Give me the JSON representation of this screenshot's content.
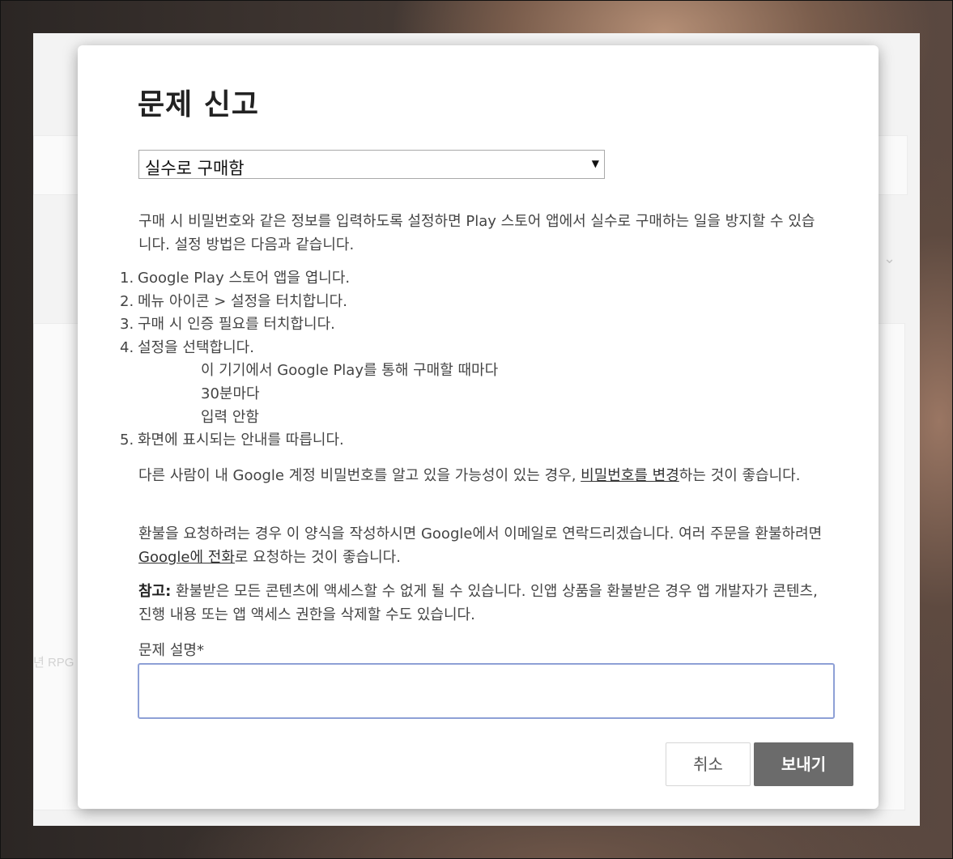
{
  "background": {
    "page_fragment_text": "년 RPG",
    "chevron_glyph": "⌄"
  },
  "dialog": {
    "title": "문제 신고",
    "issue_select": {
      "selected": "실수로 구매함",
      "arrow": "▼"
    },
    "intro": "구매 시 비밀번호와 같은 정보를 입력하도록 설정하면 Play 스토어 앱에서 실수로 구매하는 일을 방지할 수 있습니다. 설정 방법은 다음과 같습니다.",
    "steps": [
      {
        "num": "1.",
        "text": "Google Play 스토어 앱을 엽니다."
      },
      {
        "num": "2.",
        "text": "메뉴 아이콘 > 설정을 터치합니다."
      },
      {
        "num": "3.",
        "text": "구매 시 인증 필요를 터치합니다."
      },
      {
        "num": "4.",
        "text": "설정을 선택합니다."
      },
      {
        "num": "5.",
        "text": "화면에 표시되는 안내를 따릅니다."
      }
    ],
    "step4_options": [
      "이 기기에서 Google Play를 통해 구매할 때마다",
      "30분마다",
      "입력 안함"
    ],
    "password_para": {
      "before": "다른 사람이 내 Google 계정 비밀번호를 알고 있을 가능성이 있는 경우, ",
      "link": "비밀번호를 변경",
      "after": "하는 것이 좋습니다."
    },
    "refund_para": {
      "before": "환불을 요청하려는 경우 이 양식을 작성하시면 Google에서 이메일로 연락드리겠습니다. 여러 주문을 환불하려면 ",
      "link": "Google에 전화",
      "after": "로 요청하는 것이 좋습니다."
    },
    "note_para": {
      "label": "참고:",
      "text": " 환불받은 모든 콘텐츠에 액세스할 수 없게 될 수 있습니다. 인앱 상품을 환불받은 경우 앱 개발자가 콘텐츠, 진행 내용 또는 앱 액세스 권한을 삭제할 수도 있습니다."
    },
    "description_label": "문제 설명*",
    "description_value": "",
    "cancel_label": "취소",
    "send_label": "보내기"
  },
  "colors": {
    "send_button_bg": "#6b6b6b",
    "textarea_focus_border": "#8ea0d6"
  }
}
